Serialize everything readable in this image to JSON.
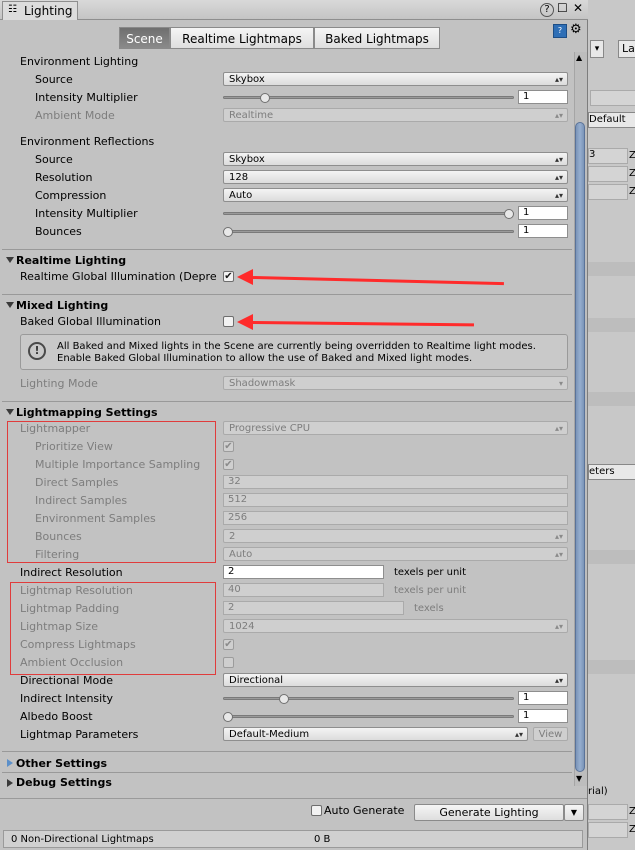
{
  "window": {
    "title": "Lighting",
    "controls": [
      "?",
      "☐",
      "✕"
    ]
  },
  "tabs": [
    {
      "label": "Scene",
      "active": true
    },
    {
      "label": "Realtime Lightmaps",
      "active": false
    },
    {
      "label": "Baked Lightmaps",
      "active": false
    }
  ],
  "env_lighting": {
    "title": "Environment Lighting",
    "source_label": "Source",
    "source_value": "Skybox",
    "intensity_label": "Intensity Multiplier",
    "intensity_value": "1",
    "intensity_fraction": 0.13,
    "ambient_label": "Ambient Mode",
    "ambient_value": "Realtime"
  },
  "env_reflections": {
    "title": "Environment Reflections",
    "source_label": "Source",
    "source_value": "Skybox",
    "resolution_label": "Resolution",
    "resolution_value": "128",
    "compression_label": "Compression",
    "compression_value": "Auto",
    "intensity_label": "Intensity Multiplier",
    "intensity_value": "1",
    "intensity_fraction": 1.0,
    "bounces_label": "Bounces",
    "bounces_value": "1",
    "bounces_fraction": 0.0
  },
  "realtime_lighting": {
    "title": "Realtime Lighting",
    "gi_label": "Realtime Global Illumination (Depre",
    "gi_checked": true
  },
  "mixed_lighting": {
    "title": "Mixed Lighting",
    "baked_gi_label": "Baked Global Illumination",
    "baked_gi_checked": false,
    "info_line1": "All Baked and Mixed lights in the Scene are currently being overridden to Realtime light modes.",
    "info_line2": "Enable Baked Global Illumination to allow the use of Baked and Mixed light modes.",
    "lighting_mode_label": "Lighting Mode",
    "lighting_mode_value": "Shadowmask"
  },
  "lightmapping": {
    "title": "Lightmapping Settings",
    "lightmapper_label": "Lightmapper",
    "lightmapper_value": "Progressive CPU",
    "prioritize_label": "Prioritize View",
    "mis_label": "Multiple Importance Sampling",
    "direct_label": "Direct Samples",
    "direct_value": "32",
    "indirect_samples_label": "Indirect Samples",
    "indirect_samples_value": "512",
    "env_samples_label": "Environment Samples",
    "env_samples_value": "256",
    "bounces_label": "Bounces",
    "bounces_value": "2",
    "filtering_label": "Filtering",
    "filtering_value": "Auto",
    "indirect_res_label": "Indirect Resolution",
    "indirect_res_value": "2",
    "texels_per_unit": "texels per unit",
    "lm_res_label": "Lightmap Resolution",
    "lm_res_value": "40",
    "lm_padding_label": "Lightmap Padding",
    "lm_padding_value": "2",
    "texels": "texels",
    "lm_size_label": "Lightmap Size",
    "lm_size_value": "1024",
    "compress_label": "Compress Lightmaps",
    "ao_label": "Ambient Occlusion",
    "dir_mode_label": "Directional Mode",
    "dir_mode_value": "Directional",
    "ind_intensity_label": "Indirect Intensity",
    "ind_intensity_value": "1",
    "ind_intensity_fraction": 0.2,
    "albedo_label": "Albedo Boost",
    "albedo_value": "1",
    "albedo_fraction": 0.0,
    "params_label": "Lightmap Parameters",
    "params_value": "Default-Medium",
    "view_button": "View"
  },
  "other_settings": {
    "title": "Other Settings"
  },
  "debug_settings": {
    "title": "Debug Settings"
  },
  "footer": {
    "auto_generate_label": "Auto Generate",
    "generate_button": "Generate Lighting",
    "status_left": "0 Non-Directional Lightmaps",
    "status_right": "0 B"
  },
  "right_panel": {
    "top_label": "La",
    "default_label": "Default",
    "z1": "Z",
    "z2": "Z",
    "z3": "Z",
    "meters": "eters",
    "rial": "rial)",
    "z4": "Z",
    "z5": "Z",
    "three": "3"
  }
}
